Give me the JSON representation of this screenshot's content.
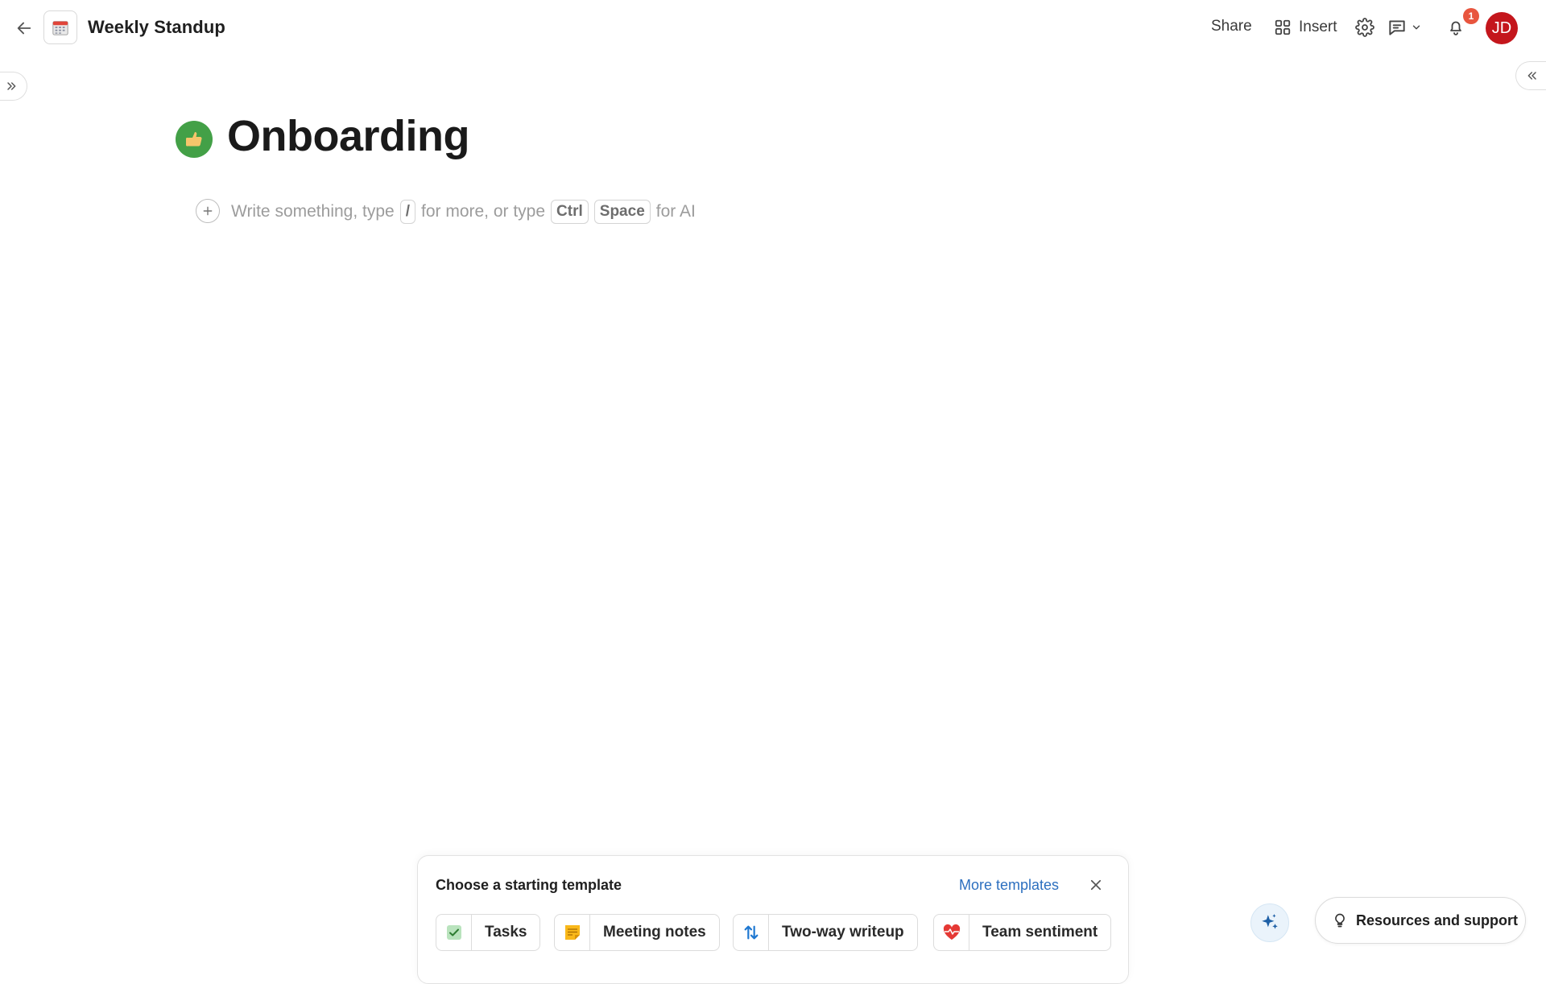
{
  "header": {
    "doc_title": "Weekly Standup",
    "share_label": "Share",
    "insert_label": "Insert",
    "notification_count": "1",
    "avatar_initials": "JD"
  },
  "page": {
    "title": "Onboarding",
    "emoji": "thumbs-up-icon"
  },
  "editor": {
    "placeholder_part1": "Write something, type",
    "slash_key": "/",
    "placeholder_part2": "for more, or type",
    "ctrl_key": "Ctrl",
    "space_key": "Space",
    "placeholder_part3": "for AI"
  },
  "template_panel": {
    "title": "Choose a starting template",
    "more_label": "More templates",
    "templates": [
      {
        "label": "Tasks",
        "icon": "checkbox-icon"
      },
      {
        "label": "Meeting notes",
        "icon": "sticky-note-icon"
      },
      {
        "label": "Two-way writeup",
        "icon": "up-down-arrows-icon"
      },
      {
        "label": "Team sentiment",
        "icon": "heart-pulse-icon"
      }
    ]
  },
  "footer": {
    "resources_label": "Resources and support"
  },
  "colors": {
    "avatar": "#c4161c",
    "badge": "#e8553e",
    "link": "#2c6fbf",
    "emoji_green": "#43a047"
  }
}
